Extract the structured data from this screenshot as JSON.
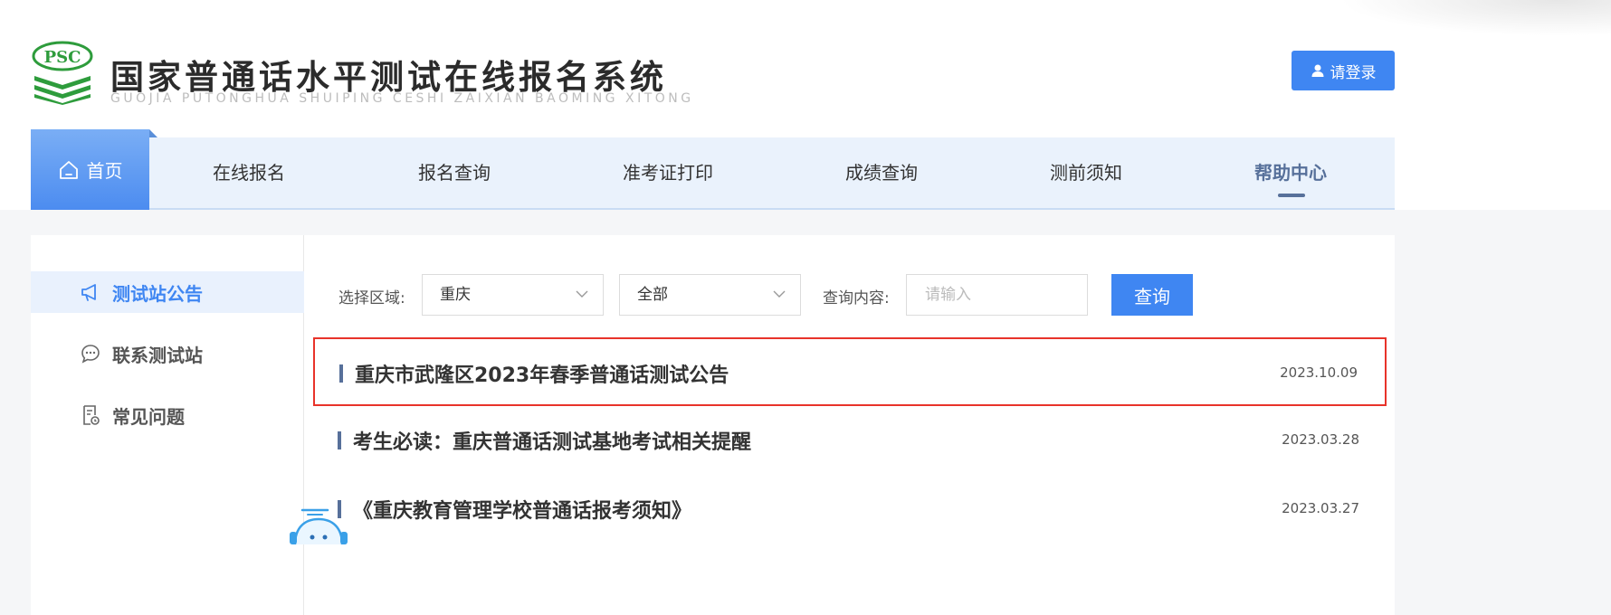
{
  "header": {
    "title": "国家普通话水平测试在线报名系统",
    "subtitle": "GUOJIA PUTONGHUA SHUIPING CESHI ZAIXIAN BAOMING XITONG",
    "logo_text": "PSC",
    "login_label": "请登录"
  },
  "nav": {
    "items": [
      {
        "label": "首页"
      },
      {
        "label": "在线报名"
      },
      {
        "label": "报名查询"
      },
      {
        "label": "准考证打印"
      },
      {
        "label": "成绩查询"
      },
      {
        "label": "测前须知"
      },
      {
        "label": "帮助中心"
      }
    ]
  },
  "sidebar": {
    "items": [
      {
        "label": "测试站公告",
        "icon": "megaphone-icon"
      },
      {
        "label": "联系测试站",
        "icon": "chat-icon"
      },
      {
        "label": "常见问题",
        "icon": "document-icon"
      }
    ]
  },
  "filters": {
    "region_label": "选择区域:",
    "region_value": "重庆",
    "district_value": "全部",
    "query_label": "查询内容:",
    "query_placeholder": "请输入",
    "query_button": "查询"
  },
  "announcements": [
    {
      "title": "重庆市武隆区2023年春季普通话测试公告",
      "date": "2023.10.09"
    },
    {
      "title": "考生必读：重庆普通话测试基地考试相关提醒",
      "date": "2023.03.28"
    },
    {
      "title": "《重庆教育管理学校普通话报考须知》",
      "date": "2023.03.27"
    }
  ],
  "colors": {
    "accent": "#3f86f2",
    "nav_bg": "#eaf2fc",
    "highlight_border": "#e8332a",
    "logo_green": "#2e9c3c"
  }
}
